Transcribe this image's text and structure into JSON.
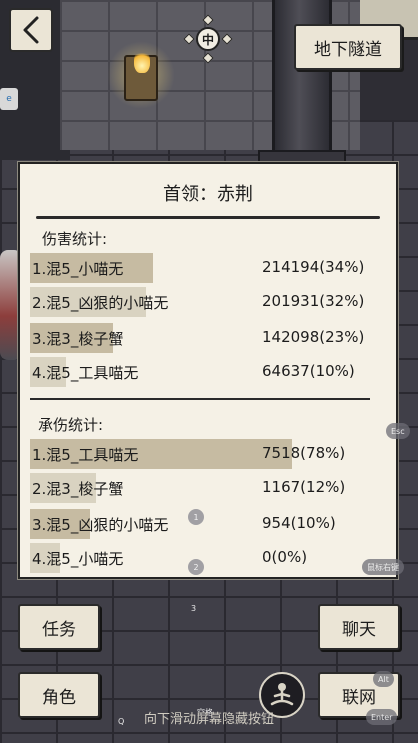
{
  "top": {
    "back_icon": "back-chevron-icon",
    "compass_char": "中",
    "location_button": "地下隧道"
  },
  "panel": {
    "title": "首领：赤荆",
    "damage_section": "伤害统计:",
    "damage_rows": [
      {
        "name": "1.混5_小喵无",
        "value": "214194(34%)",
        "share": 0.34
      },
      {
        "name": "2.混5_凶狠的小喵无",
        "value": "201931(32%)",
        "share": 0.32
      },
      {
        "name": "3.混3_梭子蟹",
        "value": "142098(23%)",
        "share": 0.23
      },
      {
        "name": "4.混5_工具喵无",
        "value": "64637(10%)",
        "share": 0.1
      }
    ],
    "tank_section": "承伤统计:",
    "tank_rows": [
      {
        "name": "1.混5_工具喵无",
        "value": "7518(78%)",
        "share": 0.78
      },
      {
        "name": "2.混3_梭子蟹",
        "value": "1167(12%)",
        "share": 0.12
      },
      {
        "name": "3.混5_凶狠的小喵无",
        "value": "954(10%)",
        "share": 0.1
      },
      {
        "name": "4.混5_小喵无",
        "value": "0(0%)",
        "share": 0.0
      }
    ]
  },
  "bottom": {
    "task_button": "任务",
    "chat_button": "聊天",
    "character_button": "角色",
    "network_button": "联网",
    "hint": "向下滑动屏幕隐藏按钮",
    "meditate_icon": "meditation-icon"
  },
  "overlay": {
    "esc": "Esc",
    "alt": "Alt",
    "enter": "Enter",
    "space": "空格",
    "q": "Q",
    "mouse_right": "鼠标右键",
    "num1": "1",
    "num2": "2",
    "num3": "3"
  },
  "colors": {
    "panel_bg": "#f5f1e6",
    "bar_dark": "#c6bba2",
    "bar_light": "#d9d3c1",
    "button_bg": "#ebe5d6"
  }
}
